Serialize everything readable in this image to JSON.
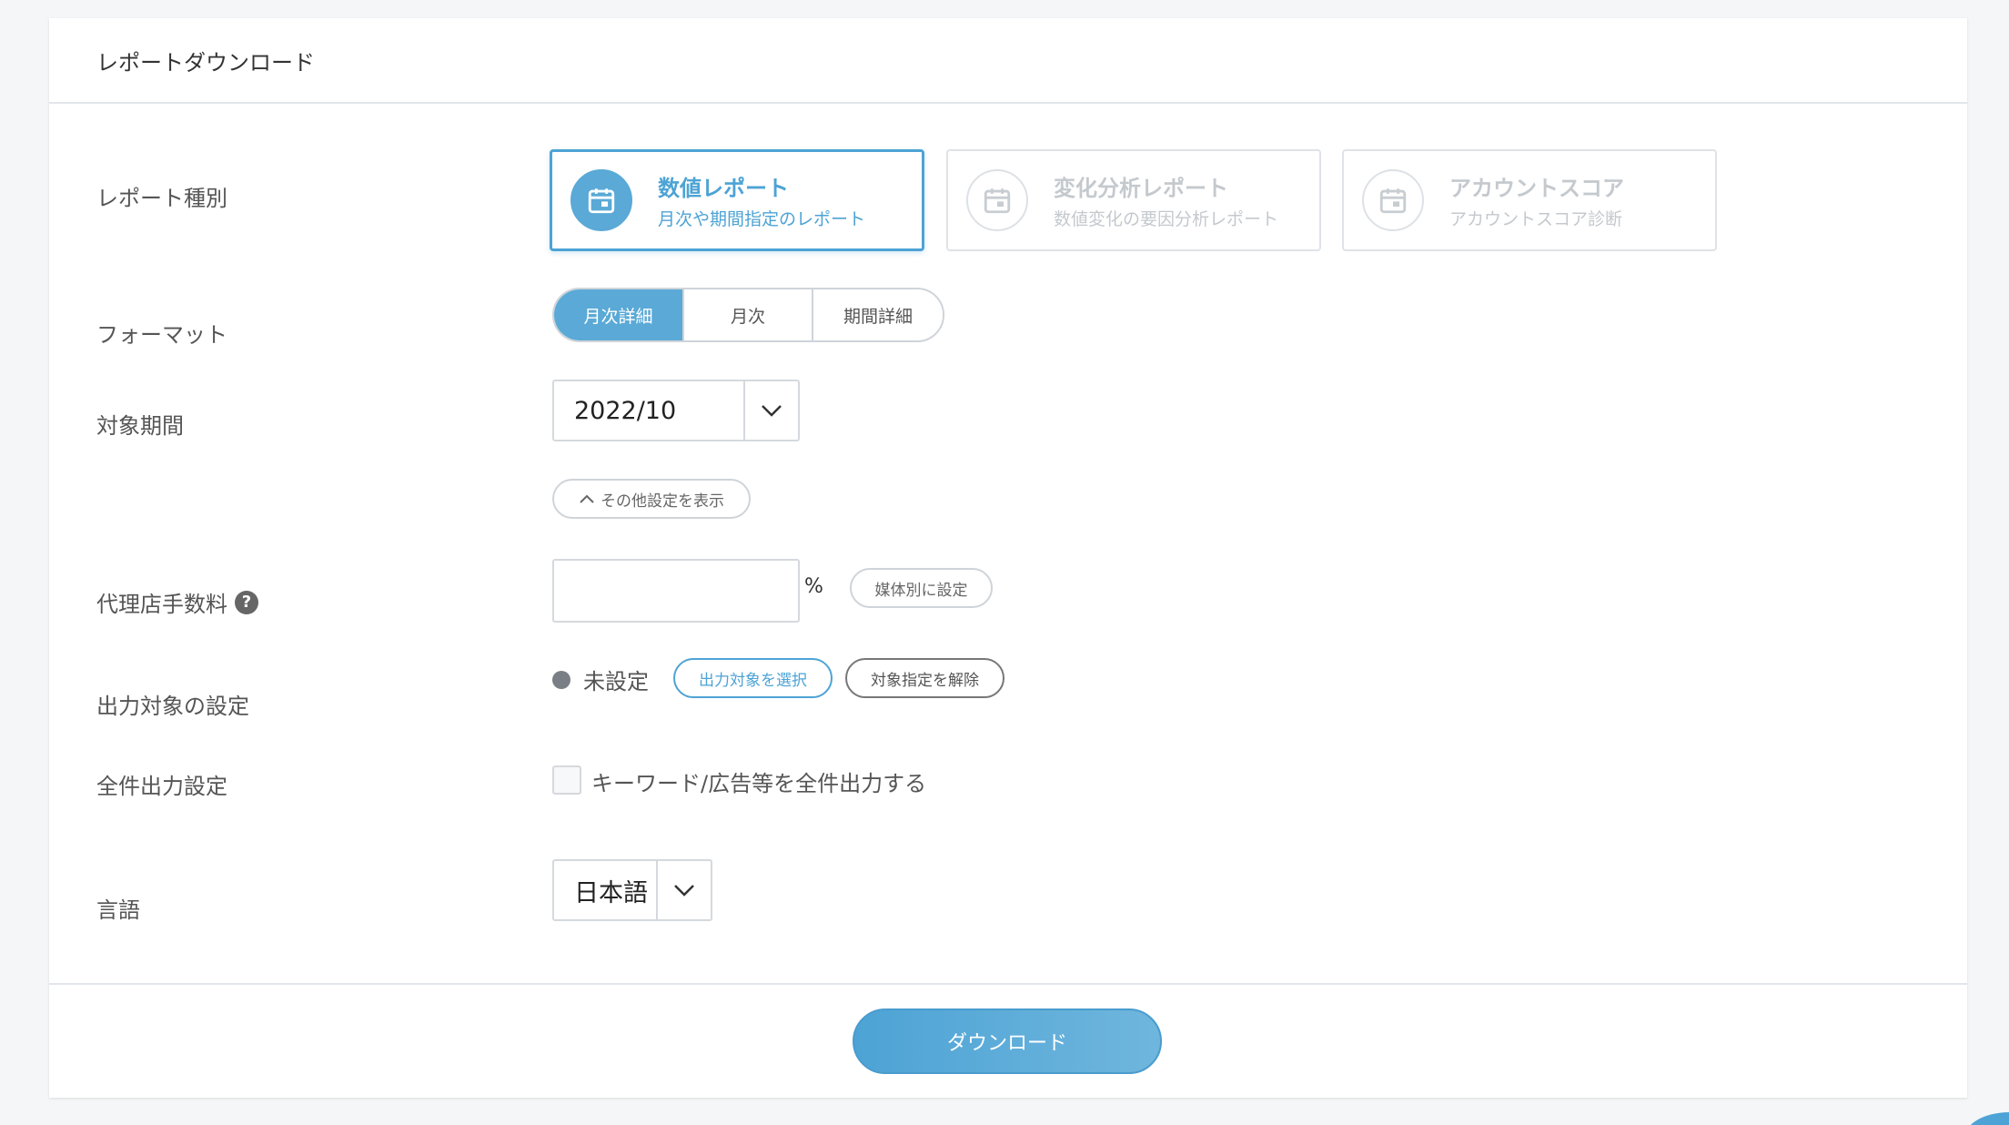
{
  "page": {
    "title": "レポートダウンロード"
  },
  "labels": {
    "report_type": "レポート種別",
    "format": "フォーマット",
    "period": "対象期間",
    "agency_fee": "代理店手数料",
    "output_target": "出力対象の設定",
    "all_output": "全件出力設定",
    "language": "言語"
  },
  "report_types": [
    {
      "title": "数値レポート",
      "subtitle": "月次や期間指定のレポート",
      "icon": "calendar-icon",
      "selected": true
    },
    {
      "title": "変化分析レポート",
      "subtitle": "数値変化の要因分析レポート",
      "icon": "calendar-icon",
      "selected": false
    },
    {
      "title": "アカウントスコア",
      "subtitle": "アカウントスコア診断",
      "icon": "calendar-icon",
      "selected": false
    }
  ],
  "format_options": [
    {
      "label": "月次詳細",
      "selected": true
    },
    {
      "label": "月次",
      "selected": false
    },
    {
      "label": "期間詳細",
      "selected": false
    }
  ],
  "period": {
    "value": "2022/10"
  },
  "other_settings": {
    "label": "その他設定を表示",
    "icon": "chevron-up-icon"
  },
  "agency_fee": {
    "value": "",
    "unit": "%",
    "media_button": "媒体別に設定"
  },
  "output_target": {
    "status": "未設定",
    "select_button": "出力対象を選択",
    "clear_button": "対象指定を解除"
  },
  "all_output": {
    "checkbox_label": "キーワード/広告等を全件出力する",
    "checked": false
  },
  "language": {
    "value": "日本語"
  },
  "footer": {
    "download_button": "ダウンロード"
  },
  "colors": {
    "accent": "#4da3d5",
    "border": "#d5d9dd",
    "background": "#f4f6f8"
  }
}
